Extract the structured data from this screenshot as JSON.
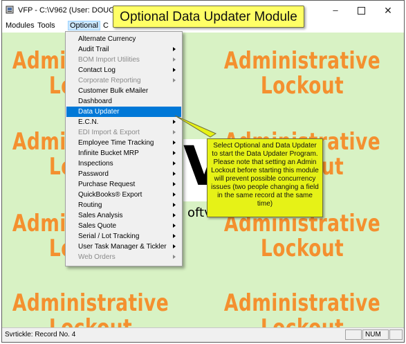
{
  "window": {
    "title": "VFP - C:\\V962  (User: DOUG",
    "minimize_glyph": "–",
    "close_glyph": "✕"
  },
  "callout_title": "Optional Data Updater Module",
  "menubar": [
    "Modules",
    "Tools",
    "Optional",
    "C"
  ],
  "background_text": {
    "line1": "Administrative",
    "line2": "Lockout"
  },
  "logo": {
    "letters": "VN",
    "sub": "oftv"
  },
  "dropdown": [
    {
      "label": "Alternate Currency",
      "disabled": false,
      "submenu": false
    },
    {
      "label": "Audit Trail",
      "disabled": false,
      "submenu": true
    },
    {
      "label": "BOM Import Utilities",
      "disabled": true,
      "submenu": true
    },
    {
      "label": "Contact Log",
      "disabled": false,
      "submenu": true
    },
    {
      "label": "Corporate Reporting",
      "disabled": true,
      "submenu": true
    },
    {
      "label": "Customer Bulk eMailer",
      "disabled": false,
      "submenu": false
    },
    {
      "label": "Dashboard",
      "disabled": false,
      "submenu": false
    },
    {
      "label": "Data Updater",
      "disabled": false,
      "submenu": false,
      "highlight": true
    },
    {
      "label": "E.C.N.",
      "disabled": false,
      "submenu": true
    },
    {
      "label": "EDI Import & Export",
      "disabled": true,
      "submenu": true
    },
    {
      "label": "Employee Time Tracking",
      "disabled": false,
      "submenu": true
    },
    {
      "label": "Infinite Bucket MRP",
      "disabled": false,
      "submenu": true
    },
    {
      "label": "Inspections",
      "disabled": false,
      "submenu": true
    },
    {
      "label": "Password",
      "disabled": false,
      "submenu": true
    },
    {
      "label": "Purchase Request",
      "disabled": false,
      "submenu": true
    },
    {
      "label": "QuickBooks® Export",
      "disabled": false,
      "submenu": true
    },
    {
      "label": "Routing",
      "disabled": false,
      "submenu": true
    },
    {
      "label": "Sales Analysis",
      "disabled": false,
      "submenu": true
    },
    {
      "label": "Sales Quote",
      "disabled": false,
      "submenu": true
    },
    {
      "label": "Serial / Lot Tracking",
      "disabled": false,
      "submenu": true
    },
    {
      "label": "User Task Manager & Tickler",
      "disabled": false,
      "submenu": true
    },
    {
      "label": "Web Orders",
      "disabled": true,
      "submenu": true
    }
  ],
  "callout_description": "Select Optional and Data Updater to start the Data Updater Program.  Please note that setting an Admin Lockout before starting this module will prevent possible concurrency issues (two people changing a field in the same record at the same time)",
  "statusbar": {
    "text": "Svrtickle: Record No. 4",
    "panel_num": "NUM"
  },
  "colors": {
    "background": "#d8f2c4",
    "lockout_text": "#f4902f",
    "callout": "#e6f217",
    "highlight": "#0078d7"
  }
}
